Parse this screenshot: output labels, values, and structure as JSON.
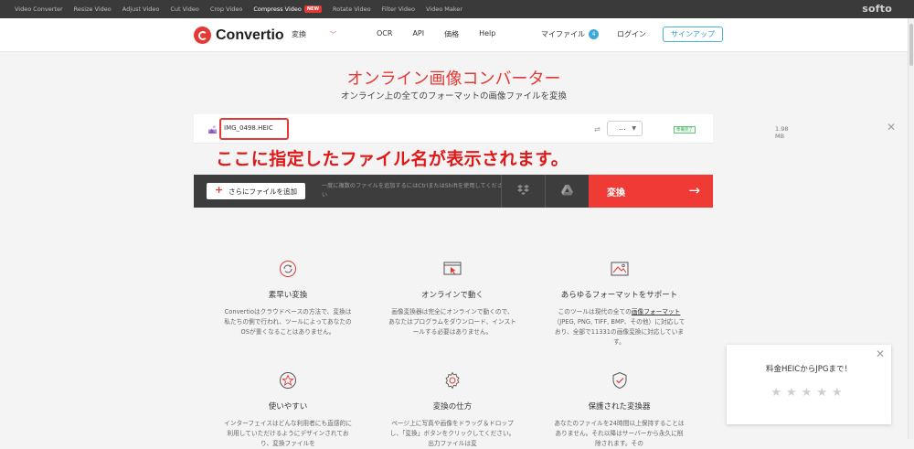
{
  "topbar": {
    "links": [
      {
        "label": "Video Converter",
        "active": false
      },
      {
        "label": "Resize Video",
        "active": false
      },
      {
        "label": "Adjust Video",
        "active": false
      },
      {
        "label": "Cut Video",
        "active": false
      },
      {
        "label": "Crop Video",
        "active": false
      },
      {
        "label": "Compress Video",
        "active": true,
        "badge": "NEW"
      },
      {
        "label": "Rotate Video",
        "active": false
      },
      {
        "label": "Filter Video",
        "active": false
      },
      {
        "label": "Video Maker",
        "active": false
      }
    ],
    "brand": "softo"
  },
  "nav": {
    "logo_text": "Convertio",
    "menu": [
      "変換",
      "OCR",
      "API",
      "価格",
      "Help"
    ],
    "my_files": "マイファイル",
    "my_files_count": "4",
    "login": "ログイン",
    "signup": "サインアップ"
  },
  "hero": {
    "title": "オンライン画像コンバーター",
    "subtitle": "オンライン上の全てのフォーマットの画像ファイルを変換"
  },
  "file": {
    "name": "IMG_0498.HEIC",
    "format_value": "...",
    "status": "準備完了",
    "size": "1.98 MB"
  },
  "annotation": "ここに指定したファイル名が表示されます。",
  "action": {
    "add_label": "さらにファイルを追加",
    "hint": "一度に複数のファイルを追加するにはCtrlまたはShiftを使用してください",
    "convert_label": "変換"
  },
  "features": [
    {
      "title": "素早い変換",
      "desc": "Convertioはクラウドベースの方法で、変換は私たちの側で行われ、ツールによってあなたのOSが重くなることはありません。"
    },
    {
      "title": "オンラインで動く",
      "desc": "画像変換器は完全にオンラインで動くので、あなたはプログラムをダウンロード、インストールする必要はありません。"
    },
    {
      "title": "あらゆるフォーマットをサポート",
      "desc_pre": "このツールは現代の全ての",
      "desc_link": "画像フォーマット",
      "desc_post": "（JPEG, PNG, TIFF, BMP、その他）に対応しており、全部で11331の画像変換に対応しています。"
    },
    {
      "title": "使いやすい",
      "desc": "インターフェイスはどんな利用者にも直感的に利用していただけるようにデザインされており、変換ファイルを"
    },
    {
      "title": "変換の仕方",
      "desc": "ページ上に写真や画像をドラッグ＆ドロップし、「変換」ボタンをクリックしてください。出力ファイルは変"
    },
    {
      "title": "保護された変換器",
      "desc": "あなたのファイルを24時間以上保持することはありません。それ以降はサーバーから永久に削除されます。その"
    }
  ],
  "popup": {
    "text": "料金HEICからJPGまで！",
    "stars": "★★★★★"
  }
}
